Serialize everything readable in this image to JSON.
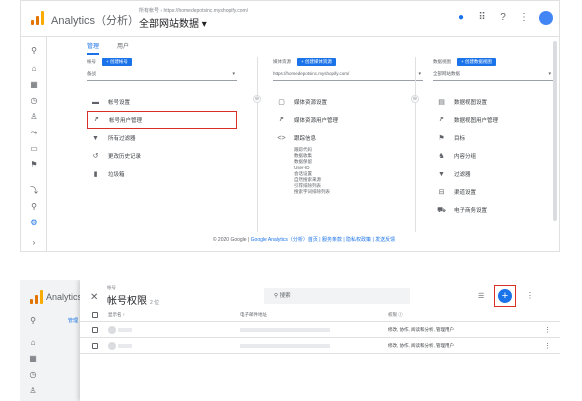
{
  "topbar": {
    "app_title": "Analytics（分析）",
    "account_path": "所有帐号 › https://homedepotsinc.myshopify.com/",
    "account_name": "全部网站数据 ▾"
  },
  "tabs": [
    {
      "label": "管理",
      "active": true
    },
    {
      "label": "用户",
      "active": false
    }
  ],
  "columns": {
    "account": {
      "label": "帐号",
      "add_label": "+ 创建帐号",
      "selected": "备战",
      "items": [
        {
          "label": "帐号设置",
          "icon": "building-icon"
        },
        {
          "label": "帐号用户管理",
          "icon": "people-icon",
          "highlighted": true
        },
        {
          "label": "所有过滤器",
          "icon": "filter-icon"
        },
        {
          "label": "更改历史记录",
          "icon": "history-icon"
        },
        {
          "label": "垃圾箱",
          "icon": "trash-icon"
        }
      ]
    },
    "property": {
      "label": "媒体资源",
      "add_label": "+ 创建媒体资源",
      "selected": "https://homedepotsinc.myshopify.com/",
      "items": [
        {
          "label": "媒体资源设置",
          "icon": "property-icon"
        },
        {
          "label": "媒体资源用户管理",
          "icon": "people-icon"
        },
        {
          "label": "跟踪信息",
          "icon": "code-icon"
        }
      ],
      "sub_items": [
        "跟踪代码",
        "数据收集",
        "数据保留",
        "User-ID",
        "会话设置",
        "自然搜索来源",
        "引荐排除列表",
        "搜索字词排除列表"
      ]
    },
    "view": {
      "label": "数据视图",
      "add_label": "+ 创建数据视图",
      "selected": "全部网站数据",
      "items": [
        {
          "label": "数据视图设置",
          "icon": "doc-icon"
        },
        {
          "label": "数据视图用户管理",
          "icon": "people-icon"
        },
        {
          "label": "目标",
          "icon": "flag-icon"
        },
        {
          "label": "内容分组",
          "icon": "person-walk-icon"
        },
        {
          "label": "过滤器",
          "icon": "filter-icon"
        },
        {
          "label": "渠道设置",
          "icon": "channel-icon"
        },
        {
          "label": "电子商务设置",
          "icon": "cart-icon"
        }
      ]
    }
  },
  "footer": {
    "copyright": "© 2020 Google | ",
    "links": "Google Analytics（分析）首页 | 服务条款 | 隐私权政策 | 发送反馈"
  },
  "panel": {
    "app_title": "Analytics",
    "nav_tab": "管理",
    "subtitle": "帐号",
    "title": "帐号权限",
    "count": "2 位",
    "search_placeholder": "搜索",
    "headers": {
      "name": "显示名 ↑",
      "email": "电子邮件地址",
      "permissions": "权限 ⓘ"
    },
    "rows": [
      {
        "permissions": "修改, 协作, 阅读和分析, 管理用户"
      },
      {
        "permissions": "修改, 协作, 阅读和分析, 管理用户"
      }
    ]
  }
}
